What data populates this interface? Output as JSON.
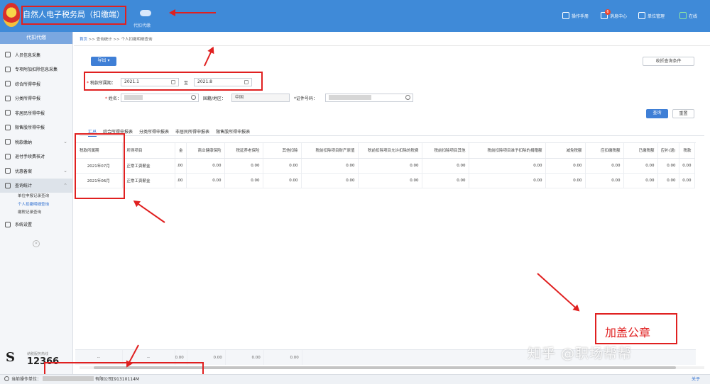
{
  "app": {
    "title": "自然人电子税务局（扣缴端）",
    "subtitle": "代扣代缴"
  },
  "toolbar": [
    {
      "label": "操作手册",
      "icon": "manual-icon"
    },
    {
      "label": "消息中心",
      "icon": "message-icon",
      "badge": "6"
    },
    {
      "label": "单位管理",
      "icon": "company-icon"
    },
    {
      "label": "在线",
      "icon": "online-icon"
    }
  ],
  "sidebar": {
    "header": "代扣代缴",
    "items": [
      {
        "label": "人员信息采集",
        "icon": "person-icon"
      },
      {
        "label": "专项附加扣除信息采集",
        "icon": "grid-icon"
      },
      {
        "label": "综合所得申报",
        "icon": "doc-icon"
      },
      {
        "label": "分类所得申报",
        "icon": "pie-icon"
      },
      {
        "label": "非居民所得申报",
        "icon": "person-icon"
      },
      {
        "label": "限售股所得申报",
        "icon": "list-icon"
      },
      {
        "label": "税款缴纳",
        "icon": "money-icon"
      },
      {
        "label": "退付手续费核对",
        "icon": "check-icon"
      },
      {
        "label": "优惠备案",
        "icon": "gift-icon"
      },
      {
        "label": "查询统计",
        "icon": "chart-icon"
      }
    ],
    "subitems": [
      "单位申报记录查询",
      "个人扣缴明细查询",
      "缴税记录查询"
    ],
    "settings": "系统设置",
    "logo": {
      "hotline_label": "纳税服务热线",
      "number": "12366"
    }
  },
  "breadcrumb": {
    "home": "首页",
    "sep": ">>",
    "level1": "查询统计",
    "level2": "个人扣缴明细查询"
  },
  "buttons": {
    "export": "导出",
    "collapse": "收折查询条件",
    "query": "查询",
    "reset": "重置"
  },
  "form": {
    "period_label": "税款所属期：",
    "period_from": "2021.1",
    "period_to_label": "至",
    "period_to": "2021.8",
    "name_label": "姓名：",
    "region_label": "国籍/地区：",
    "region_value": "中国",
    "id_label": "*证件号码："
  },
  "tabs": [
    "汇总",
    "综合所得申报表",
    "分类所得申报表",
    "非居民所得申报表",
    "限售股所得申报表"
  ],
  "table": {
    "headers": [
      "税款所属期",
      "所得项目",
      "金",
      "商业健康保险",
      "税延养老保险",
      "其他扣除",
      "税前扣除项目财产原值",
      "税前扣除项目允许扣除的税费",
      "税前扣除项目其他",
      "税前扣除项目准予扣除的捐赠额",
      "减免税额",
      "应扣缴税额",
      "已缴税额",
      "应补(退)",
      "税款"
    ],
    "rows": [
      [
        "2021年07月",
        "正常工资薪金",
        ".00",
        "0.00",
        "0.00",
        "0.00",
        "0.00",
        "0.00",
        "0.00",
        "0.00",
        "0.00",
        "0.00",
        "0.00",
        "0.00",
        "0.00"
      ],
      [
        "2021年06月",
        "正常工资薪金",
        ".00",
        "0.00",
        "0.00",
        "0.00",
        "0.00",
        "0.00",
        "0.00",
        "0.00",
        "0.00",
        "0.00",
        "0.00",
        "0.00",
        "0.00"
      ]
    ],
    "footer": [
      "--",
      "--",
      "0.00",
      "0.00",
      "0.00",
      "0.00"
    ]
  },
  "statusbar": {
    "prefix": "当前操作单位：",
    "company": "有限公司[91310114M",
    "about": "关于"
  },
  "annotations": {
    "stamp": "加盖公章",
    "watermark": "知乎 @职场帮帮"
  }
}
